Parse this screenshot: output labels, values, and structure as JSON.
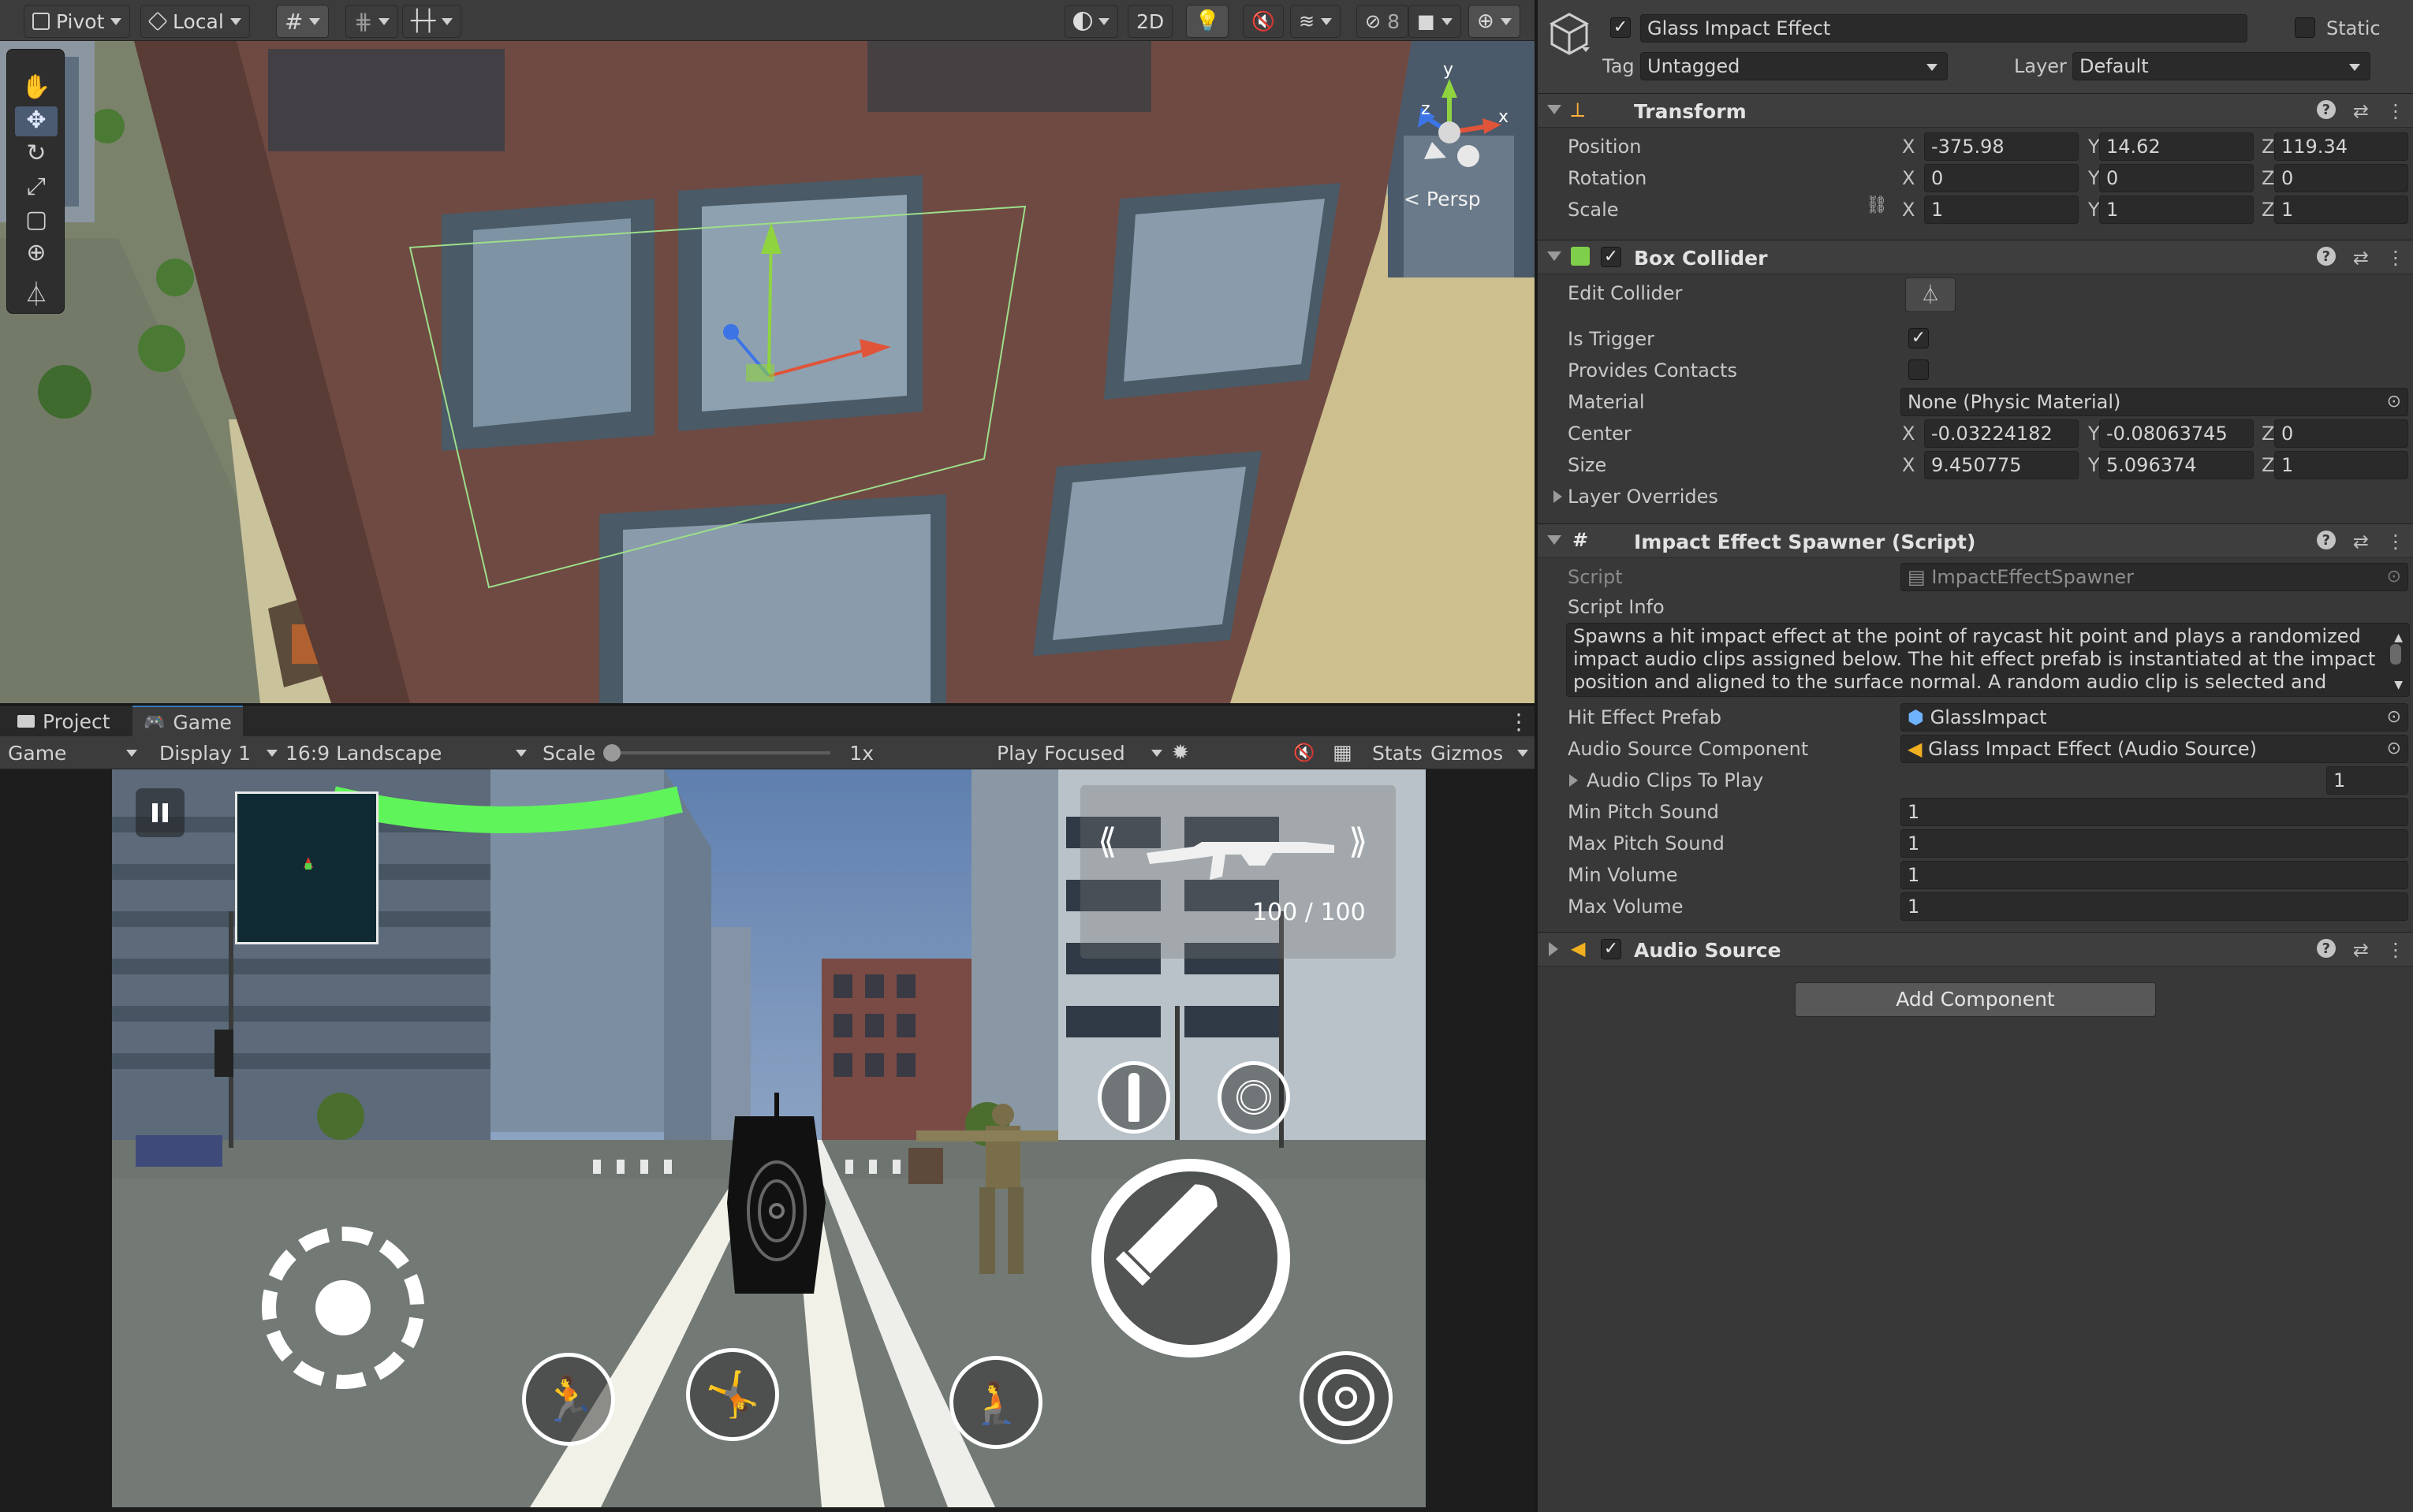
{
  "toolbar": {
    "pivot_label": "Pivot",
    "local_label": "Local",
    "mode_2d_label": "2D"
  },
  "scene": {
    "persp_label": "< Persp",
    "gizmo_axes": {
      "x": "x",
      "y": "y",
      "z": "z"
    }
  },
  "tabs": {
    "project_label": "Project",
    "game_label": "Game"
  },
  "game_toolbar": {
    "game_dropdown": "Game",
    "display_dropdown": "Display 1",
    "aspect_dropdown": "16:9 Landscape",
    "scale_label": "Scale",
    "scale_value": "1x",
    "play_mode_dropdown": "Play Focused",
    "stats_label": "Stats",
    "gizmos_label": "Gizmos"
  },
  "game_hud": {
    "ammo": "100 / 100",
    "health_fraction": 1.0,
    "prev_weapon": "⟪",
    "next_weapon": "⟫"
  },
  "inspector": {
    "object": {
      "name": "Glass Impact Effect",
      "static_label": "Static",
      "tag_label": "Tag",
      "tag_value": "Untagged",
      "layer_label": "Layer",
      "layer_value": "Default"
    },
    "transform": {
      "title": "Transform",
      "rows": [
        {
          "label": "Position",
          "x": "-375.98",
          "y": "14.62",
          "z": "119.34"
        },
        {
          "label": "Rotation",
          "x": "0",
          "y": "0",
          "z": "0"
        },
        {
          "label": "Scale",
          "x": "1",
          "y": "1",
          "z": "1"
        }
      ]
    },
    "box_collider": {
      "title": "Box Collider",
      "edit_collider_label": "Edit Collider",
      "is_trigger_label": "Is Trigger",
      "provides_contacts_label": "Provides Contacts",
      "material_label": "Material",
      "material_value": "None (Physic Material)",
      "center_label": "Center",
      "center": {
        "x": "-0.03224182",
        "y": "-0.08063745",
        "z": "0"
      },
      "size_label": "Size",
      "size": {
        "x": "9.450775",
        "y": "5.096374",
        "z": "1"
      },
      "layer_overrides_label": "Layer Overrides"
    },
    "spawner": {
      "title": "Impact Effect Spawner (Script)",
      "script_label": "Script",
      "script_value": "ImpactEffectSpawner",
      "script_info_label": "Script Info",
      "script_info_text": "Spawns a hit impact effect at the point of raycast hit point and plays a randomized impact audio clips assigned below. The hit effect prefab is instantiated at the impact position and aligned to the surface normal. A random audio clip is selected and played using an",
      "hit_effect_prefab_label": "Hit Effect Prefab",
      "hit_effect_prefab_value": "GlassImpact",
      "audio_source_label": "Audio Source Component",
      "audio_source_value": "Glass Impact Effect (Audio Source)",
      "audio_clips_label": "Audio Clips To Play",
      "audio_clips_count": "1",
      "min_pitch_label": "Min Pitch Sound",
      "min_pitch_value": "1",
      "max_pitch_label": "Max Pitch Sound",
      "max_pitch_value": "1",
      "min_volume_label": "Min Volume",
      "min_volume_value": "1",
      "max_volume_label": "Max Volume",
      "max_volume_value": "1"
    },
    "audio_source": {
      "title": "Audio Source"
    },
    "add_component_label": "Add Component"
  },
  "colors": {
    "accent": "#3a79bb",
    "health_bar": "#5ff55a",
    "axis_x": "#e0543a",
    "axis_y": "#8fd43f",
    "axis_z": "#3c74e6"
  }
}
